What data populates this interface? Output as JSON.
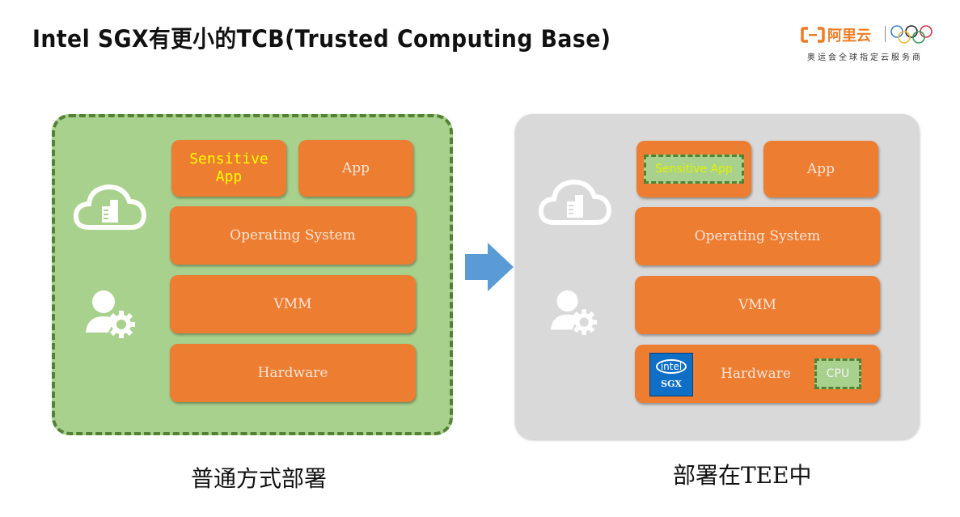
{
  "header": {
    "title": "Intel SGX有更小的TCB(Trusted Computing Base)"
  },
  "logo": {
    "brand": "阿里云",
    "subtitle": "奥运会全球指定云服务商",
    "brand_color": "#f07c22",
    "rings": [
      "olympic-ring-blue",
      "olympic-ring-yellow",
      "olympic-ring-black",
      "olympic-ring-green",
      "olympic-ring-red"
    ]
  },
  "left": {
    "caption": "普通方式部署",
    "icons": [
      "cloud-building-icon",
      "user-gear-icon"
    ],
    "layers": {
      "sensitive_app": "Sensitive App",
      "app": "App",
      "os": "Operating System",
      "vmm": "VMM",
      "hardware": "Hardware"
    }
  },
  "arrow": {
    "icon": "arrow-right-icon",
    "color": "#5b9bd5"
  },
  "right": {
    "caption": "部署在TEE中",
    "icons": [
      "cloud-building-icon",
      "user-gear-icon"
    ],
    "layers": {
      "sensitive_app": "Sensitive App",
      "app": "App",
      "os": "Operating System",
      "vmm": "VMM",
      "hardware": "Hardware",
      "cpu": "CPU"
    },
    "intel_badge": {
      "brand": "intel",
      "label": "SGX"
    }
  },
  "colors": {
    "layer_orange": "#ed7d31",
    "trusted_green": "#a9d18e",
    "trusted_border": "#548235",
    "tee_panel_gray": "#d9d9d9",
    "sensitive_text": "#ffff00"
  }
}
